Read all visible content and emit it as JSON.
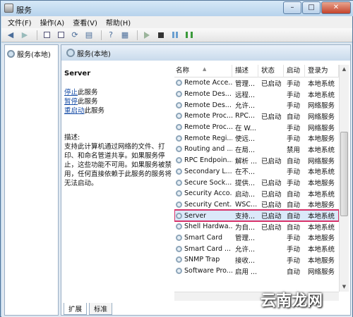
{
  "window": {
    "title": "服务",
    "controls": [
      "minimize",
      "maximize",
      "close"
    ]
  },
  "menu": [
    "文件(F)",
    "操作(A)",
    "查看(V)",
    "帮助(H)"
  ],
  "toolbar": {
    "icons": [
      "back-icon",
      "forward-icon",
      "console-tree-icon",
      "properties-icon",
      "refresh-icon",
      "export-icon",
      "help-icon",
      "view-icon",
      "start-icon",
      "stop-icon",
      "pause-icon",
      "restart-icon"
    ]
  },
  "tree": {
    "root_label": "服务(本地)"
  },
  "main": {
    "header_title": "服务(本地)",
    "selected_title": "Server",
    "actions": [
      {
        "link": "停止",
        "suffix": "此服务"
      },
      {
        "link": "暂停",
        "suffix": "此服务"
      },
      {
        "link": "重启动",
        "suffix": "此服务"
      }
    ],
    "description_label": "描述:",
    "description_text": "支持此计算机通过网络的文件、打印、和命名管道共享。如果服务停止，这些功能不可用。如果服务被禁用，任何直接依赖于此服务的服务将无法启动。"
  },
  "table": {
    "headers": [
      "名称",
      "描述",
      "状态",
      "启动",
      "登录为"
    ],
    "rows": [
      [
        "Remote Acce...",
        "管理...",
        "已启动",
        "手动",
        "本地系统"
      ],
      [
        "Remote Des...",
        "远程...",
        "",
        "手动",
        "本地系统"
      ],
      [
        "Remote Des...",
        "允许...",
        "",
        "手动",
        "网络服务"
      ],
      [
        "Remote Proc...",
        "RPC...",
        "已启动",
        "自动",
        "网络服务"
      ],
      [
        "Remote Proc...",
        "在 W...",
        "",
        "手动",
        "网络服务"
      ],
      [
        "Remote Regi...",
        "使远...",
        "",
        "手动",
        "本地服务"
      ],
      [
        "Routing and ...",
        "在局...",
        "",
        "禁用",
        "本地系统"
      ],
      [
        "RPC Endpoin...",
        "解析 ...",
        "已启动",
        "自动",
        "网络服务"
      ],
      [
        "Secondary L...",
        "在不...",
        "",
        "手动",
        "本地系统"
      ],
      [
        "Secure Sock...",
        "提供...",
        "已启动",
        "手动",
        "本地服务"
      ],
      [
        "Security Acco...",
        "启动...",
        "已启动",
        "自动",
        "本地系统"
      ],
      [
        "Security Cent...",
        "WSC...",
        "已启动",
        "自动",
        "本地服务"
      ],
      [
        "Server",
        "支持...",
        "已启动",
        "自动",
        "本地系统"
      ],
      [
        "Shell Hardwa...",
        "为自...",
        "已启动",
        "自动",
        "本地系统"
      ],
      [
        "Smart Card",
        "管理...",
        "",
        "手动",
        "本地服务"
      ],
      [
        "Smart Card ...",
        "允许...",
        "",
        "手动",
        "本地系统"
      ],
      [
        "SNMP Trap",
        "接收...",
        "",
        "手动",
        "本地服务"
      ],
      [
        "Software Pro...",
        "启用 ...",
        "",
        "自动",
        "网络服务"
      ]
    ],
    "selected_index": 12
  },
  "tabs": [
    "扩展",
    "标准"
  ],
  "watermark": "云南龙网"
}
